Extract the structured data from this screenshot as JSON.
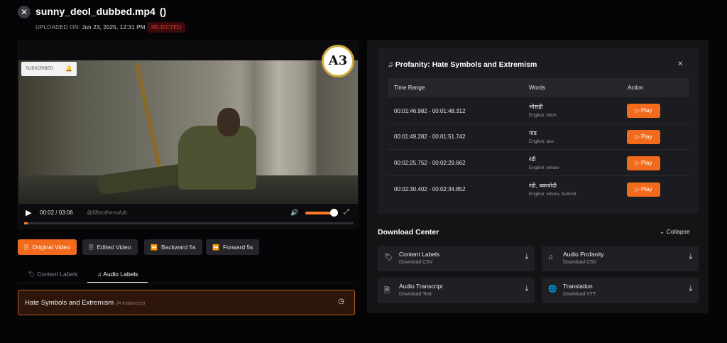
{
  "header": {
    "title": "sunny_deol_dubbed.mp4",
    "paren": "()",
    "uploaded_label": "UPLOADED ON:",
    "uploaded_value": "Jun 23, 2025, 12:31 PM",
    "status": "REJECTED",
    "close_glyph": "✕"
  },
  "video": {
    "subscribe_text": "SUBSCRIBED",
    "logo_text": "A3",
    "time": "00:02 / 03:06",
    "watermark": "@filbrothersdub",
    "progress_fraction": 0.01,
    "volume_fraction": 0.9
  },
  "buttons": [
    {
      "label": "Original Video",
      "icon": "file-icon"
    },
    {
      "label": "Edited Video",
      "icon": "file-icon"
    },
    {
      "label": "Backward 5s",
      "icon": "rewind-icon"
    },
    {
      "label": "Forward 5s",
      "icon": "fast-forward-icon"
    }
  ],
  "tabs": [
    {
      "label": "Content Labels",
      "icon": "tag-icon"
    },
    {
      "label": "Audio Labels",
      "icon": "music-icon"
    }
  ],
  "label_item": {
    "label": "Hate Symbols and Extremism",
    "count": "(4 instances)"
  },
  "profanity": {
    "title": "Profanity: Hate Symbols and Extremism",
    "columns": [
      "Time Range",
      "Words",
      "Action"
    ],
    "rows": [
      {
        "time": "00:01:46.982 - 00:01:48.312",
        "word": "भोसड़ी",
        "english": "English: bitch",
        "action": "Play"
      },
      {
        "time": "00:01:49.282 - 00:01:51.742",
        "word": "गांड",
        "english": "English: ass",
        "action": "Play"
      },
      {
        "time": "00:02:25.752 - 00:02:29.662",
        "word": "रंडी",
        "english": "English: whore",
        "action": "Play"
      },
      {
        "time": "00:02:30.402 - 00:02:34.852",
        "word": "रंडी, बकचोदी",
        "english": "English: whore, bullshit",
        "action": "Play"
      }
    ]
  },
  "download": {
    "title": "Download Center",
    "collapse": "Collapse",
    "items": [
      {
        "name": "Content Labels",
        "sub": "Download CSV",
        "icon": "tag-icon"
      },
      {
        "name": "Audio Profanity",
        "sub": "Download CSV",
        "icon": "music-icon"
      },
      {
        "name": "Audio Transcript",
        "sub": "Download Text",
        "icon": "document-icon"
      },
      {
        "name": "Translation",
        "sub": "Download VTT",
        "icon": "globe-icon"
      }
    ]
  },
  "colors": {
    "accent": "#f26b1d",
    "rejected": "#dc3b3b"
  }
}
